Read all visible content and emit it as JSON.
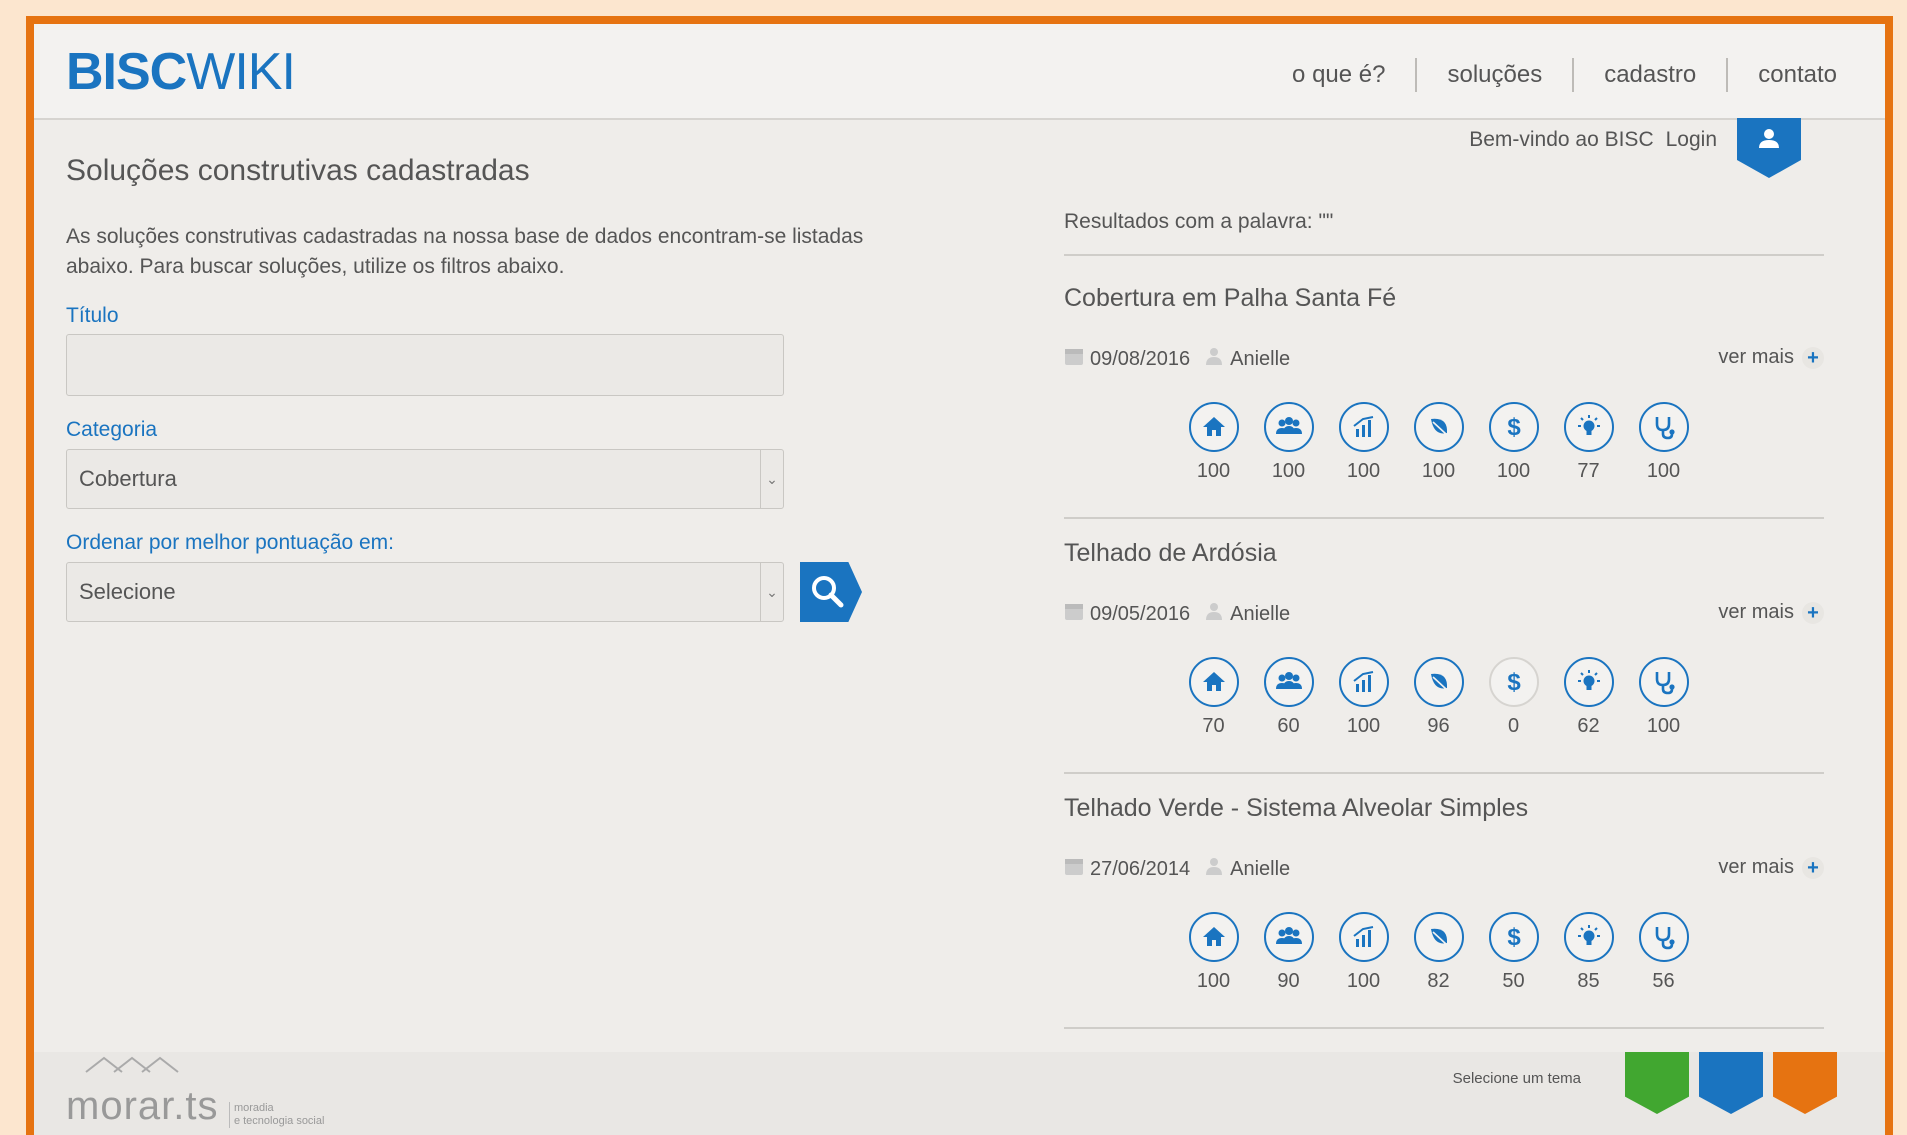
{
  "header": {
    "logo_bold": "BISC",
    "logo_light": "WIKI",
    "nav": [
      "o que é?",
      "soluções",
      "cadastro",
      "contato"
    ],
    "welcome": "Bem-vindo ao BISC",
    "login": "Login"
  },
  "main": {
    "title": "Soluções construtivas cadastradas",
    "intro": "As soluções construtivas cadastradas na nossa base de dados encontram-se listadas abaixo. Para buscar soluções, utilize os filtros abaixo.",
    "title_label": "Título",
    "title_value": "",
    "category_label": "Categoria",
    "category_value": "Cobertura",
    "order_label": "Ordenar por melhor pontuação em:",
    "order_value": "Selecione"
  },
  "results": {
    "heading": "Resultados com a palavra: \"\"",
    "more_label": "ver mais",
    "icons": [
      "home-icon",
      "people-icon",
      "chart-icon",
      "leaf-icon",
      "dollar-icon",
      "lightbulb-icon",
      "stethoscope-icon"
    ],
    "items": [
      {
        "title": "Cobertura em Palha Santa Fé",
        "date": "09/08/2016",
        "author": "Anielle",
        "scores": [
          "100",
          "100",
          "100",
          "100",
          "100",
          "77",
          "100"
        ]
      },
      {
        "title": "Telhado de Ardósia",
        "date": "09/05/2016",
        "author": "Anielle",
        "scores": [
          "70",
          "60",
          "100",
          "96",
          "0",
          "62",
          "100"
        ]
      },
      {
        "title": "Telhado Verde - Sistema Alveolar Simples",
        "date": "27/06/2014",
        "author": "Anielle",
        "scores": [
          "100",
          "90",
          "100",
          "82",
          "50",
          "85",
          "56"
        ]
      }
    ]
  },
  "footer": {
    "brand": "morar.ts",
    "tagline_1": "moradia",
    "tagline_2": "e tecnologia social",
    "theme_label": "Selecione um tema",
    "themes": [
      "#41a730",
      "#1a74c0",
      "#e67311"
    ]
  },
  "colors": {
    "accent": "#1a74c0",
    "border": "#e67311"
  }
}
